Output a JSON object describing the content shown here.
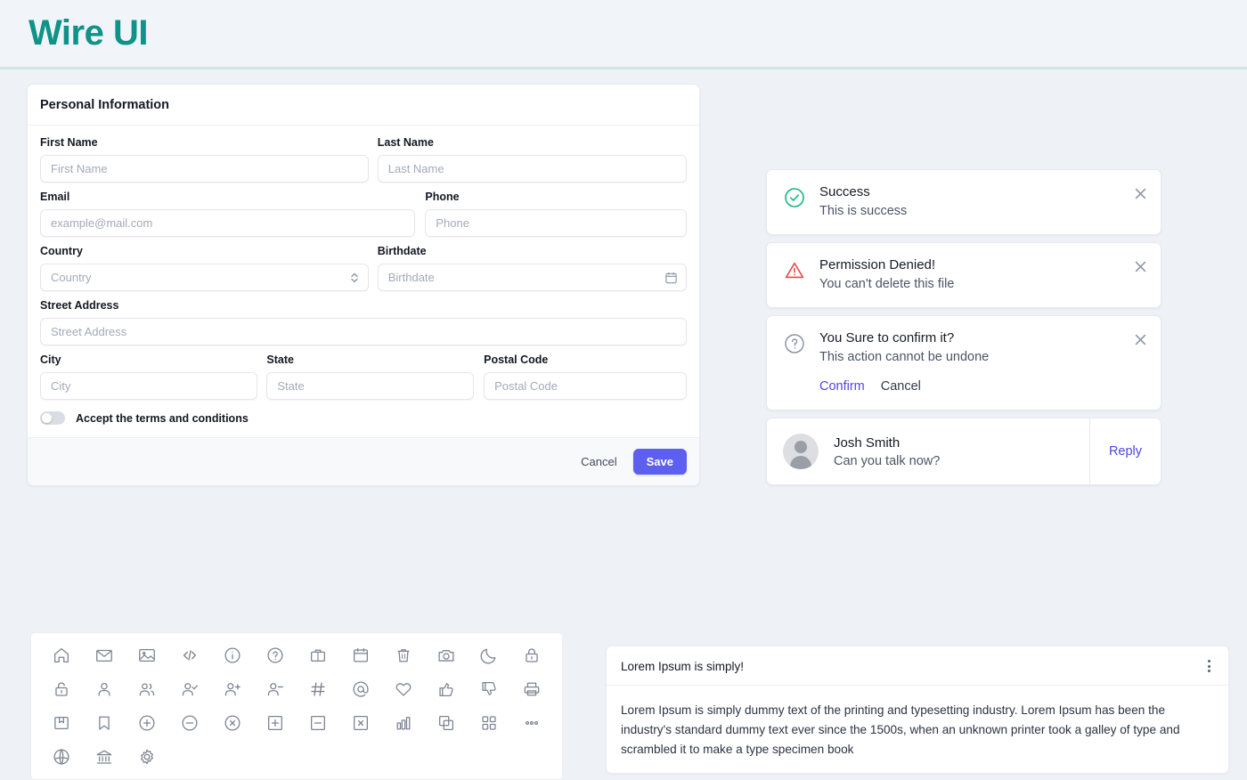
{
  "header": {
    "brand": "Wire UI"
  },
  "form": {
    "title": "Personal Information",
    "fields": [
      {
        "label": "First Name",
        "placeholder": "First Name"
      },
      {
        "label": "Last Name",
        "placeholder": "Last Name"
      },
      {
        "label": "Email",
        "placeholder": "example@mail.com"
      },
      {
        "label": "Phone",
        "placeholder": "Phone"
      },
      {
        "label": "Country",
        "placeholder": "Country"
      },
      {
        "label": "Birthdate",
        "placeholder": "Birthdate"
      },
      {
        "label": "Street Address",
        "placeholder": "Street Address"
      },
      {
        "label": "City",
        "placeholder": "City"
      },
      {
        "label": "State",
        "placeholder": "State"
      },
      {
        "label": "Postal Code",
        "placeholder": "Postal Code"
      }
    ],
    "toggle_label": "Accept the terms and conditions",
    "toggle_state": "off",
    "cancel_label": "Cancel",
    "save_label": "Save",
    "save_color": "#5d5fef"
  },
  "alerts": [
    {
      "icon": "check-circle-icon",
      "title": "Success",
      "message": "This is success",
      "color": "#10b981"
    },
    {
      "icon": "warning-triangle-icon",
      "title": "Permission Denied!",
      "message": "You can't delete this file",
      "color": "#ef4444"
    },
    {
      "icon": "question-circle-icon",
      "title": "You Sure to confirm it?",
      "message": "This action cannot be undone",
      "color": "#8c95a4",
      "confirm_label": "Confirm",
      "cancel_label": "Cancel"
    }
  ],
  "message_card": {
    "name": "Josh Smith",
    "text": "Can you talk now?",
    "reply_label": "Reply"
  },
  "icon_grid": {
    "icons": [
      "home-icon",
      "mail-icon",
      "image-icon",
      "code-icon",
      "info-icon",
      "question-icon",
      "briefcase-icon",
      "calendar-icon",
      "trash-icon",
      "camera-icon",
      "moon-icon",
      "lock-closed-icon",
      "lock-open-icon",
      "user-icon",
      "users-icon",
      "user-check-icon",
      "user-plus-icon",
      "user-minus-icon",
      "hash-icon",
      "at-sign-icon",
      "heart-icon",
      "thumbs-up-icon",
      "thumbs-down-icon",
      "printer-icon",
      "book-icon",
      "bookmark-icon",
      "plus-circle-icon",
      "minus-circle-icon",
      "close-circle-icon",
      "plus-square-icon",
      "minus-square-icon",
      "close-square-icon",
      "bar-chart-icon",
      "copy-icon",
      "grid-icon",
      "ellipsis-icon",
      "globe-icon",
      "bank-icon",
      "gear-icon"
    ]
  },
  "lorem_card": {
    "title": "Lorem Ipsum is simply!",
    "menu": "kebab-menu-icon",
    "body": "Lorem Ipsum is simply dummy text of the printing and typesetting industry. Lorem Ipsum has been the industry's standard dummy text ever since the 1500s, when an unknown printer took a galley of type and scrambled it to make a type specimen book"
  }
}
